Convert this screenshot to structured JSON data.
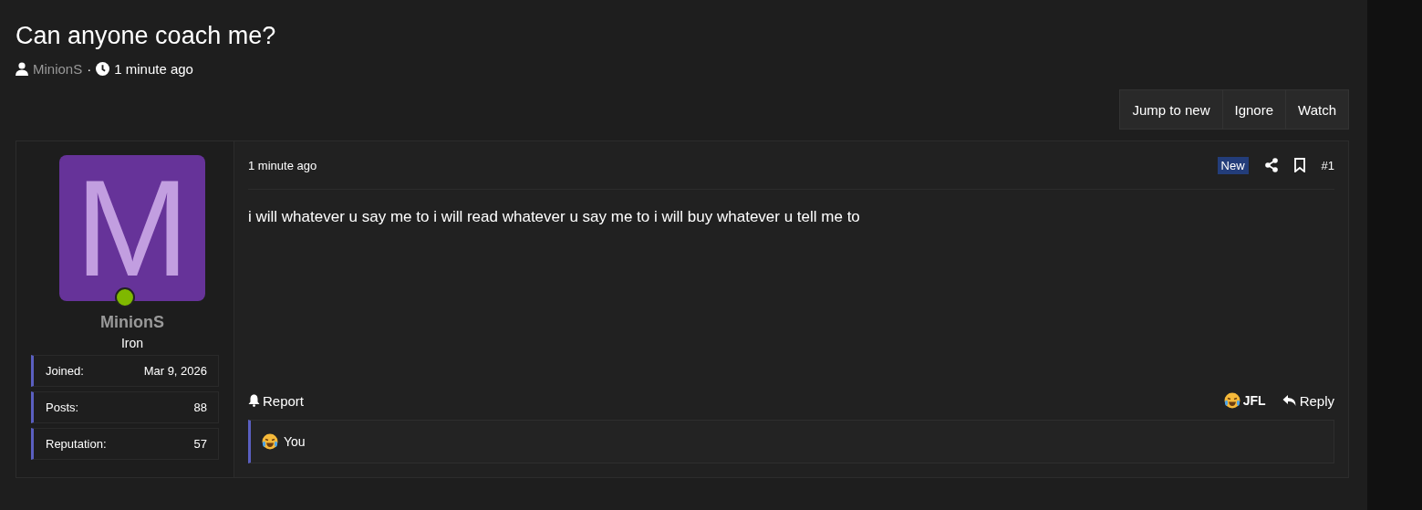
{
  "thread": {
    "title": "Can anyone coach me?",
    "author": "MinionS",
    "separator": "·",
    "time": "1 minute ago"
  },
  "buttons": [
    "Jump to new",
    "Ignore",
    "Watch"
  ],
  "post": {
    "user": {
      "avatar_letter": "M",
      "online": true,
      "name": "MinionS",
      "rank": "Iron",
      "stats": [
        {
          "label": "Joined:",
          "value": "Mar 9, 2026"
        },
        {
          "label": "Posts:",
          "value": "88"
        },
        {
          "label": "Reputation:",
          "value": "57"
        }
      ]
    },
    "time": "1 minute ago",
    "badge": "New",
    "number": "#1",
    "body": "i will whatever u say me to i will read whatever u say me to i will buy whatever u tell me to",
    "report": "Report",
    "reaction": "JFL",
    "reply": "Reply",
    "reacted_by": "You"
  }
}
